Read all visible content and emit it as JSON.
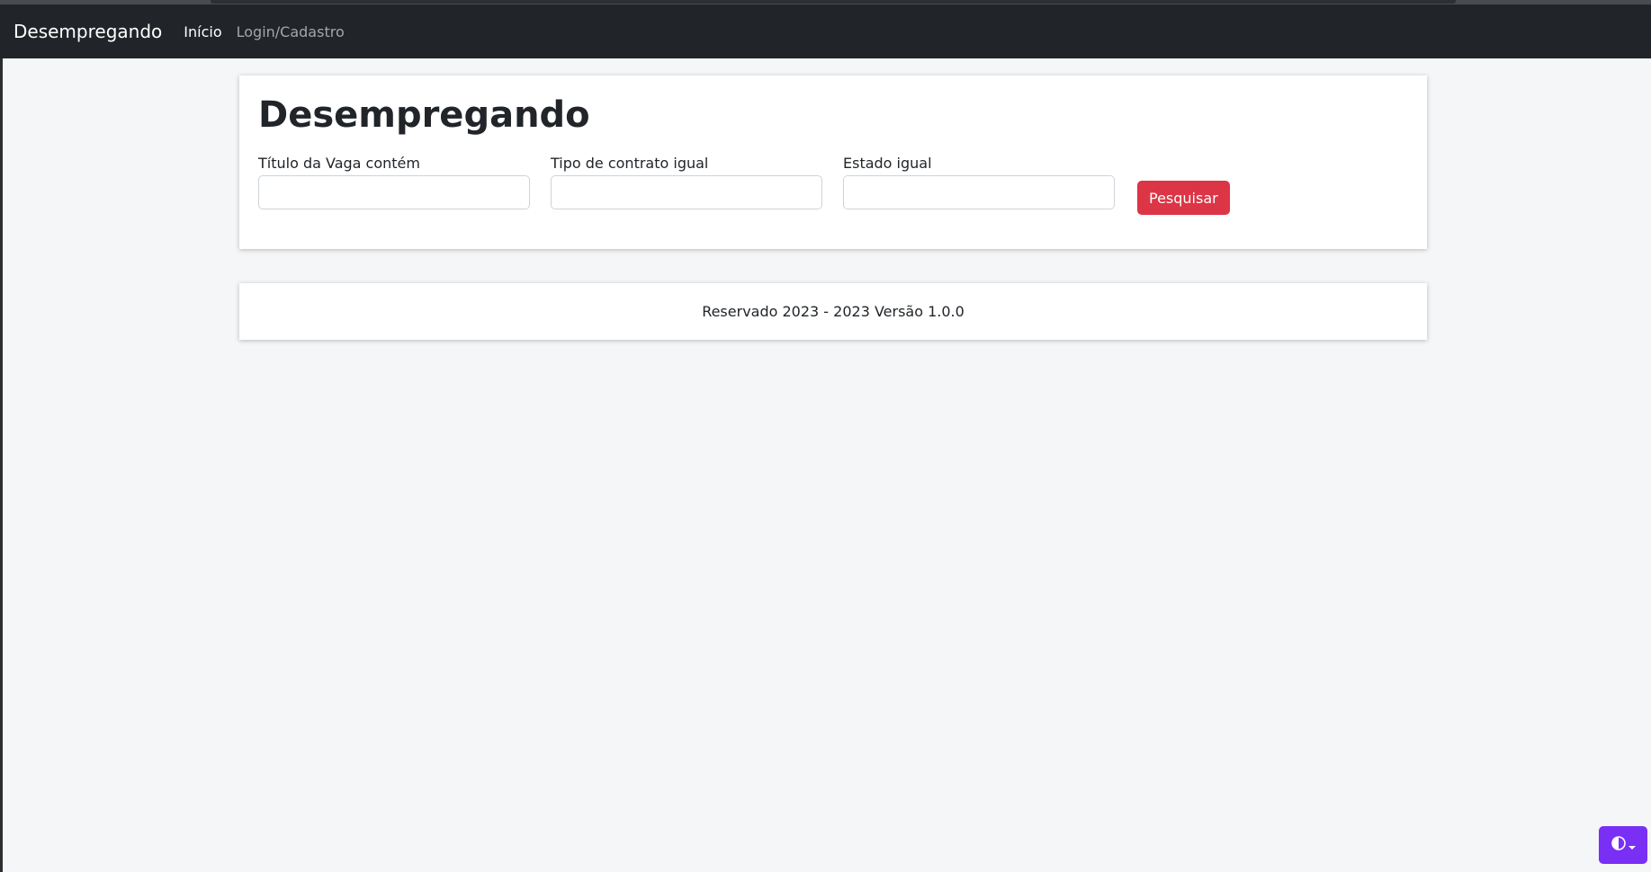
{
  "navbar": {
    "brand": "Desempregando",
    "links": [
      {
        "label": "Início",
        "active": true
      },
      {
        "label": "Login/Cadastro",
        "active": false
      }
    ]
  },
  "search": {
    "title": "Desempregando",
    "fields": [
      {
        "label": "Título da Vaga contém",
        "value": ""
      },
      {
        "label": "Tipo de contrato igual",
        "value": ""
      },
      {
        "label": "Estado igual",
        "value": ""
      }
    ],
    "button_label": "Pesquisar"
  },
  "footer": {
    "text": "Reservado 2023 - 2023 Versão 1.0.0"
  },
  "theme_toggle": {
    "icon": "half-circle-contrast-icon",
    "caret_icon": "caret-down-icon",
    "color": "#7a2ff5"
  },
  "colors": {
    "navbar_bg": "#212529",
    "button_bg": "#dc3545",
    "page_bg": "#f5f6f8"
  }
}
